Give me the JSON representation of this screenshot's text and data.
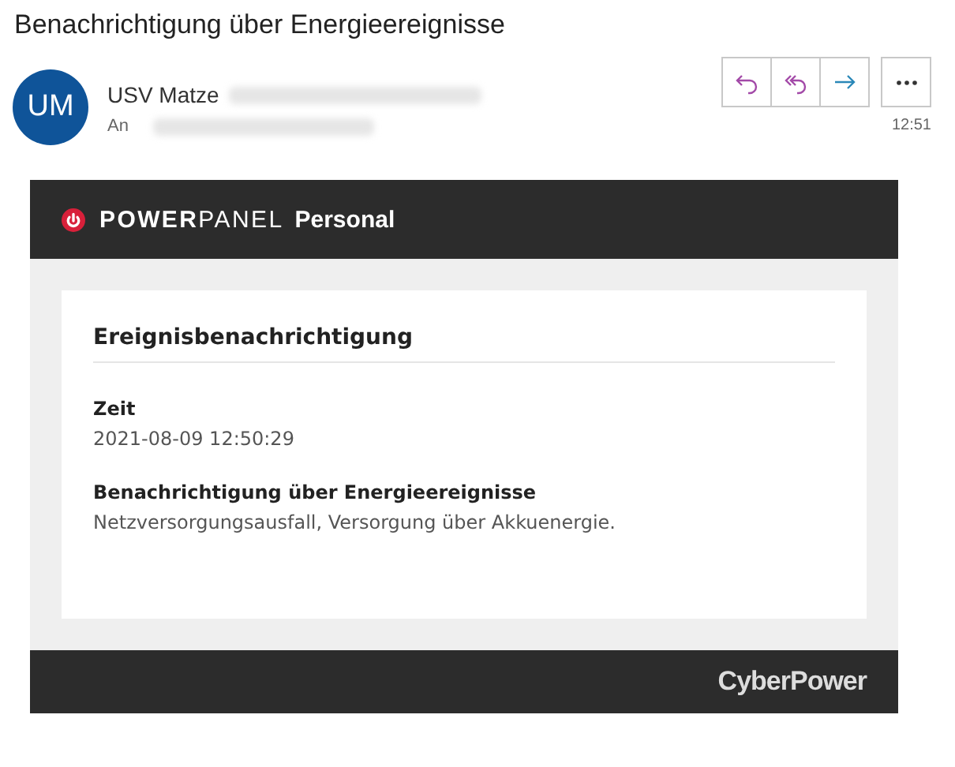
{
  "subject": "Benachrichtigung über Energieereignisse",
  "sender": {
    "initials": "UM",
    "name": "USV Matze",
    "to_label": "An",
    "time": "12:51"
  },
  "actions": [
    {
      "kind": "reply"
    },
    {
      "kind": "reply_all"
    },
    {
      "kind": "forward"
    },
    {
      "kind": "more"
    }
  ],
  "mail": {
    "brand": "**POWER**PANEL",
    "edition": "Personal",
    "card_title": "Ereignisbenachrichtigung",
    "fields": [
      {
        "label": "Zeit",
        "value": "2021-08-09 12:50:29"
      },
      {
        "label": "Benachrichtigung über Energieereignisse",
        "value": "Netzversorgungsausfall, Versorgung über Akkuenergie."
      }
    ],
    "footer_logo": "CyberPower"
  }
}
